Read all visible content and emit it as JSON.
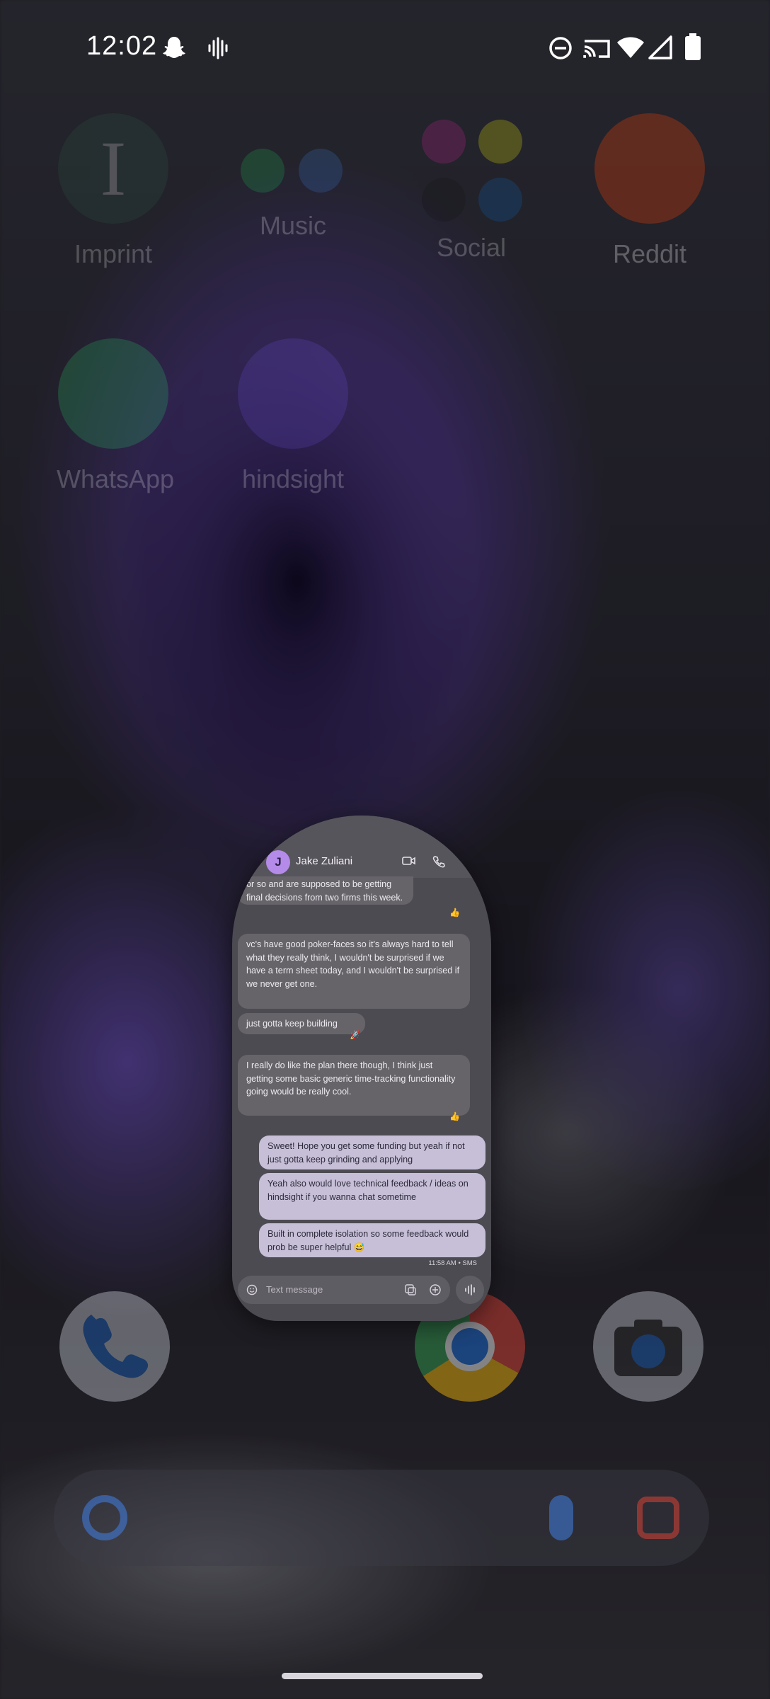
{
  "status_bar": {
    "time": "12:02",
    "icons": [
      "snapchat-notification-icon",
      "voice-activity-icon",
      "do-not-disturb-icon",
      "cast-icon",
      "wifi-icon",
      "cell-signal-icon",
      "battery-icon"
    ]
  },
  "home": {
    "apps": [
      {
        "label": "Imprint"
      },
      {
        "label": "Music"
      },
      {
        "label": "Social"
      },
      {
        "label": "Reddit"
      },
      {
        "label": "WhatsApp"
      },
      {
        "label": "hindsight"
      }
    ],
    "dock": [
      "phone-icon",
      "chrome-icon",
      "camera-icon"
    ]
  },
  "chat": {
    "contact_initial": "J",
    "contact_name": "Jake Zuliani",
    "messages": [
      {
        "dir": "in",
        "text": "or so and are supposed to be getting final decisions from two firms this week.",
        "reaction": "👍"
      },
      {
        "dir": "in",
        "text": "vc's have good poker-faces so it's always hard to tell what they really think, I wouldn't be surprised if we have a term sheet today, and I wouldn't be surprised if we never get one."
      },
      {
        "dir": "in",
        "text": "just gotta keep building",
        "reaction": "🚀"
      },
      {
        "dir": "in",
        "text": "I really do like the plan there though, I think just getting some basic generic time-tracking functionality going would be really cool.",
        "reaction": "👍"
      },
      {
        "dir": "out",
        "text": "Sweet! Hope you get some funding but yeah if not just gotta keep grinding and applying"
      },
      {
        "dir": "out",
        "text": "Yeah also would love technical feedback / ideas on hindsight if you wanna chat sometime"
      },
      {
        "dir": "out",
        "text": "Built in complete isolation so some feedback would prob be super helpful 😅"
      }
    ],
    "meta": "11:58 AM • SMS",
    "composer_placeholder": "Text message"
  },
  "colors": {
    "outgoing_bubble": "#c6bfd7",
    "incoming_bubble": "#666469",
    "avatar": "#b48be8"
  }
}
